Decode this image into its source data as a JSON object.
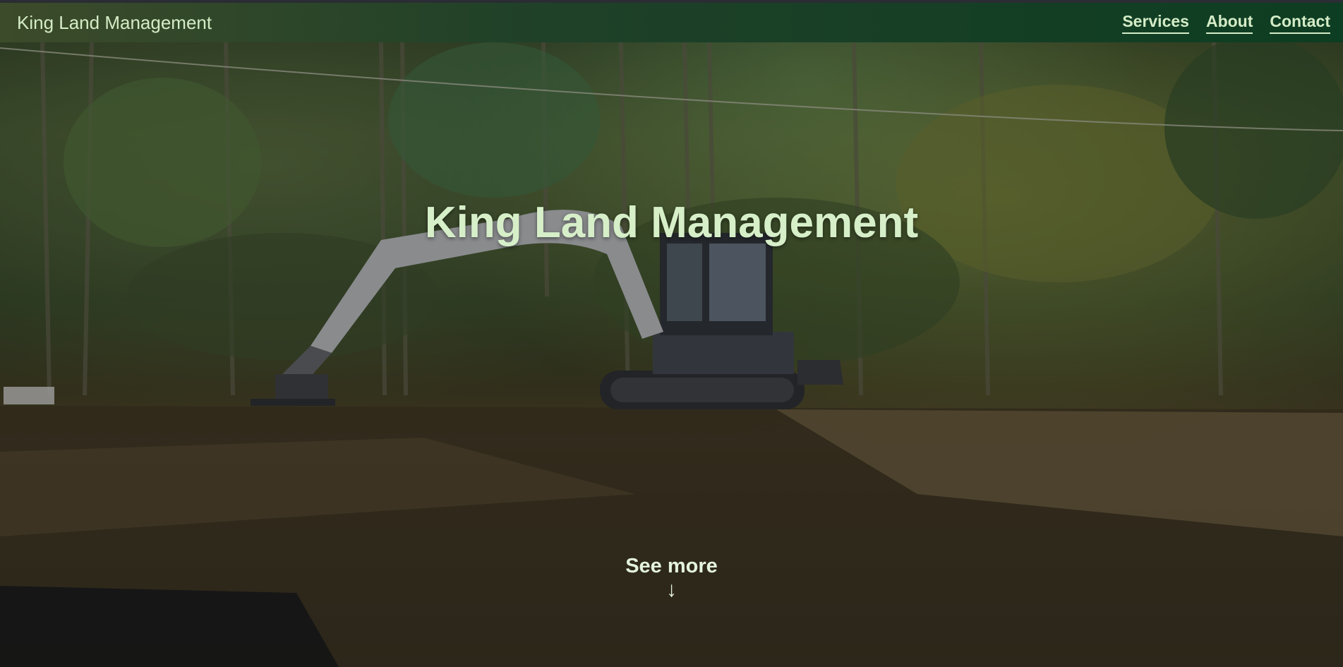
{
  "navbar": {
    "brand": "King Land Management",
    "links": [
      {
        "label": "Services"
      },
      {
        "label": "About"
      },
      {
        "label": "Contact"
      }
    ]
  },
  "hero": {
    "title": "King Land Management",
    "see_more_label": "See more",
    "see_more_arrow": "↓"
  },
  "colors": {
    "nav_text": "#d4ecc6",
    "title_text": "#d6efc9",
    "nav_bg_start": "#3c4b2a",
    "nav_bg_end": "#0d3d22"
  }
}
